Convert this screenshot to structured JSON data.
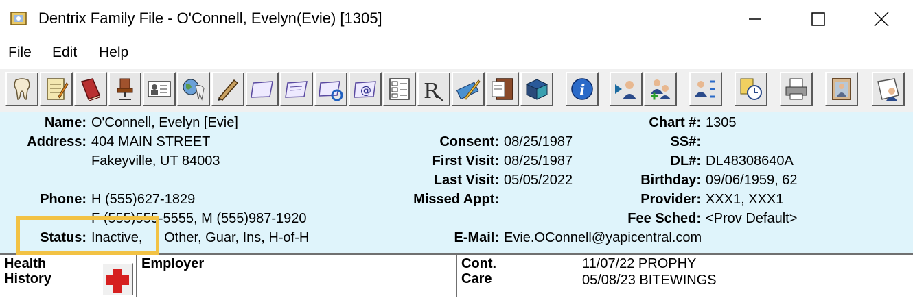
{
  "window": {
    "title": "Dentrix Family File - O'Connell, Evelyn(Evie) [1305]"
  },
  "menu": {
    "items": [
      "File",
      "Edit",
      "Help"
    ]
  },
  "toolbar": {
    "buttons": [
      {
        "name": "tooth-icon"
      },
      {
        "name": "notepad-icon"
      },
      {
        "name": "book-icon"
      },
      {
        "name": "office-chair-icon"
      },
      {
        "name": "id-card-icon"
      },
      {
        "name": "globe-tooth-icon"
      },
      {
        "name": "pen-icon"
      },
      {
        "name": "blank-card-icon"
      },
      {
        "name": "lines-card-icon"
      },
      {
        "name": "refresh-card-icon"
      },
      {
        "name": "email-card-icon"
      },
      {
        "name": "list-grid-icon"
      },
      {
        "name": "rx-icon"
      },
      {
        "name": "pencil-ruler-icon"
      },
      {
        "name": "file-cabinet-icon"
      },
      {
        "name": "box-icon"
      },
      {
        "name": "info-icon"
      },
      {
        "name": "patient-arrow-icon"
      },
      {
        "name": "add-family-icon"
      },
      {
        "name": "family-members-icon"
      },
      {
        "name": "clock-reminder-icon"
      },
      {
        "name": "printer-icon"
      },
      {
        "name": "picture-frame-icon"
      },
      {
        "name": "patient-card-icon"
      }
    ]
  },
  "patient": {
    "name_label": "Name:",
    "name": "O'Connell, Evelyn [Evie]",
    "address_label": "Address:",
    "address_line1": "404 MAIN STREET",
    "address_line2": "Fakeyville, UT  84003",
    "phone_label": "Phone:",
    "phone_line1": "H (555)627-1829",
    "phone_line2": "F (555)555-5555, M (555)987-1920",
    "status_label": "Status:",
    "status_value": "Inactive,",
    "status_rest": ", Other, Guar, Ins, H-of-H",
    "consent_label": "Consent:",
    "consent": "08/25/1987",
    "first_visit_label": "First Visit:",
    "first_visit": "08/25/1987",
    "last_visit_label": "Last Visit:",
    "last_visit": "05/05/2022",
    "missed_appt_label": "Missed Appt:",
    "missed_appt": "",
    "email_label": "E-Mail:",
    "email": "Evie.OConnell@yapicentral.com",
    "chart_label": "Chart #:",
    "chart": "1305",
    "ss_label": "SS#:",
    "ss": "",
    "dl_label": "DL#:",
    "dl": "DL48308640A",
    "birthday_label": "Birthday:",
    "birthday": "09/06/1959, 62",
    "provider_label": "Provider:",
    "provider": "XXX1, XXX1",
    "fee_sched_label": "Fee Sched:",
    "fee_sched": "<Prov Default>"
  },
  "bottom": {
    "health_label_1": "Health",
    "health_label_2": "History",
    "employer_label": "Employer",
    "cont_label_1": "Cont.",
    "cont_label_2": "Care",
    "care_line1": "11/07/22 PROPHY",
    "care_line2": "05/08/23 BITEWINGS"
  },
  "colors": {
    "panel_bg": "#dff4fb",
    "highlight": "#f2c244",
    "health_cross": "#d62020"
  }
}
